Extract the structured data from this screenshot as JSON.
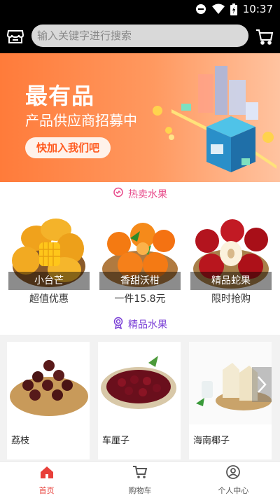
{
  "status_bar": {
    "time": "10:37"
  },
  "header": {
    "search_placeholder": "输入关键字进行搜索"
  },
  "banner": {
    "title": "最有品",
    "subtitle": "产品供应商招募中",
    "button": "快加入我们吧"
  },
  "hot_section": {
    "title": "热卖水果",
    "title_color": "#e84a8a",
    "items": [
      {
        "name": "小台芒",
        "desc": "超值优惠"
      },
      {
        "name": "香甜沃柑",
        "desc": "一件15.8元"
      },
      {
        "name": "精品蛇果",
        "desc": "限时抢购"
      }
    ]
  },
  "premium_section": {
    "title": "精品水果",
    "title_color": "#7a3fd6",
    "items": [
      {
        "name": "荔枝"
      },
      {
        "name": "车厘子"
      },
      {
        "name": "海南椰子"
      }
    ]
  },
  "bottom_nav": {
    "items": [
      {
        "label": "首页",
        "icon": "home-icon",
        "active": true
      },
      {
        "label": "购物车",
        "icon": "cart-icon",
        "active": false
      },
      {
        "label": "个人中心",
        "icon": "user-icon",
        "active": false
      }
    ],
    "active_color": "#e8403a"
  }
}
